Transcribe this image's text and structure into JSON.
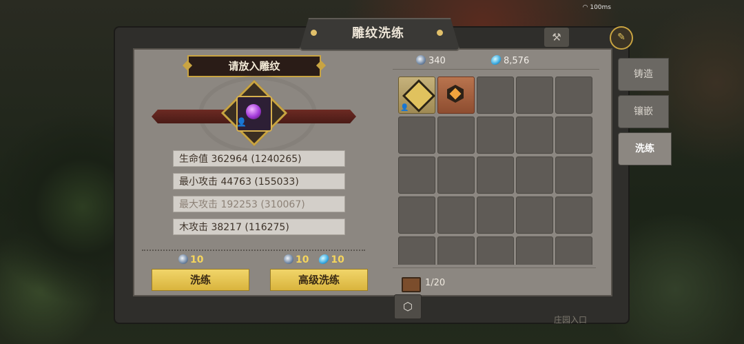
{
  "status": {
    "ping": "100ms"
  },
  "window": {
    "title": "雕纹洗练"
  },
  "left": {
    "slot_header": "请放入雕纹",
    "stats": [
      {
        "label": "生命值 362964 (1240265)"
      },
      {
        "label": "最小攻击 44763 (155033)"
      },
      {
        "label": "最大攻击 192253 (310067)"
      },
      {
        "label": "木攻击 38217 (116275)"
      }
    ],
    "costs": {
      "refine_stone": "10",
      "adv_stone": "10",
      "adv_crystal": "10"
    },
    "buttons": {
      "refine": "洗练",
      "advanced_refine": "高级洗练"
    }
  },
  "resources": {
    "stone": "340",
    "crystal": "8,576"
  },
  "inventory": {
    "capacity": "1/20"
  },
  "side_tabs": [
    {
      "label": "铸造"
    },
    {
      "label": "镶嵌"
    },
    {
      "label": "洗练"
    }
  ],
  "map_label": "庄园入口",
  "colors": {
    "accent_gold": "#e1c06a",
    "panel": "#8c8781",
    "button": "#d9b43d"
  }
}
